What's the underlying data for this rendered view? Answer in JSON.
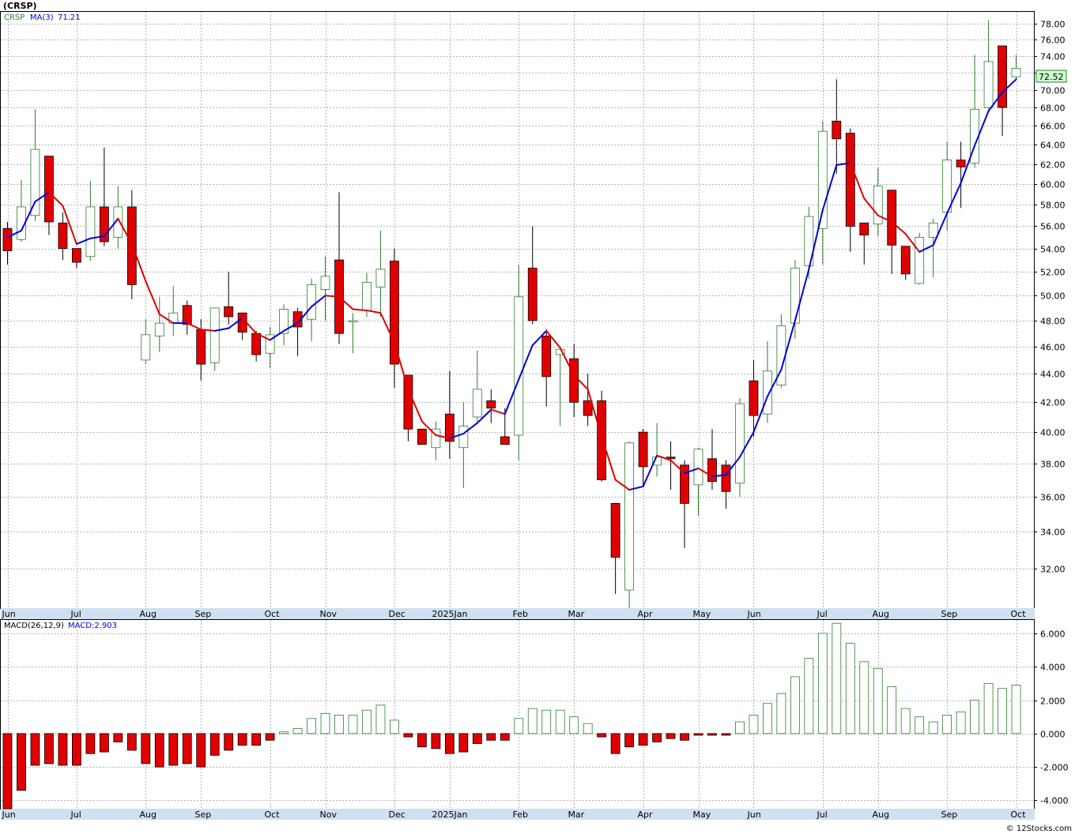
{
  "title": "(CRSP)",
  "legend": {
    "symbol": "CRSP",
    "ma_label": "MA(3)",
    "ma_value": "71.21",
    "macd_params": "MACD(26,12,9)",
    "macd_value": "MACD:2.903"
  },
  "last_price_badge": "72.52",
  "copyright": "© 12Stocks.com",
  "colors": {
    "up_candle": "#ffffff",
    "up_outline": "#2e7d32",
    "down_candle": "#e00000",
    "ma_up": "#0000dd",
    "ma_down": "#e00000",
    "macd_pos": "#2e7d32",
    "macd_neg": "#e00000",
    "grid": "#b5b5b5",
    "axis_bar": "#cfe0f0",
    "badge_bg": "#ccffcc"
  },
  "chart_data": [
    {
      "type": "candlestick",
      "interval": "weekly",
      "y_scale": "log",
      "ylim": [
        30,
        79.5
      ],
      "y_ticks": [
        "32.00",
        "34.00",
        "36.00",
        "38.00",
        "40.00",
        "42.00",
        "44.00",
        "46.00",
        "48.00",
        "50.00",
        "52.00",
        "54.00",
        "56.00",
        "58.00",
        "60.00",
        "62.00",
        "64.00",
        "66.00",
        "68.00",
        "70.00",
        "72.00",
        "74.00",
        "76.00",
        "78.00"
      ],
      "x_month_labels": [
        "Jun",
        "Jul",
        "Aug",
        "Sep",
        "Oct",
        "Nov",
        "Dec",
        "2025Jan",
        "Feb",
        "Mar",
        "Apr",
        "May",
        "Jun",
        "Jul",
        "Aug",
        "Sep",
        "Oct"
      ],
      "month_start_index": [
        0,
        5,
        10,
        14,
        19,
        23,
        28,
        32,
        37,
        41,
        46,
        50,
        54,
        59,
        63,
        68,
        73
      ],
      "candles": [
        {
          "o": 55.8,
          "h": 56.4,
          "l": 52.6,
          "c": 53.8
        },
        {
          "o": 54.8,
          "h": 60.4,
          "l": 54.6,
          "c": 57.8
        },
        {
          "o": 57.0,
          "h": 67.8,
          "l": 56.5,
          "c": 63.5
        },
        {
          "o": 62.8,
          "h": 62.8,
          "l": 55.2,
          "c": 56.4
        },
        {
          "o": 56.3,
          "h": 57.3,
          "l": 53.0,
          "c": 54.0
        },
        {
          "o": 54.0,
          "h": 54.0,
          "l": 52.3,
          "c": 52.8
        },
        {
          "o": 53.3,
          "h": 60.3,
          "l": 52.9,
          "c": 57.8
        },
        {
          "o": 57.8,
          "h": 63.7,
          "l": 54.2,
          "c": 54.6
        },
        {
          "o": 55.0,
          "h": 59.8,
          "l": 54.0,
          "c": 57.8
        },
        {
          "o": 57.8,
          "h": 59.4,
          "l": 49.7,
          "c": 50.9
        },
        {
          "o": 45.0,
          "h": 48.1,
          "l": 44.7,
          "c": 46.9
        },
        {
          "o": 46.8,
          "h": 49.9,
          "l": 45.6,
          "c": 47.8
        },
        {
          "o": 47.8,
          "h": 50.8,
          "l": 46.8,
          "c": 48.6
        },
        {
          "o": 49.2,
          "h": 49.6,
          "l": 46.9,
          "c": 47.7
        },
        {
          "o": 47.3,
          "h": 48.1,
          "l": 43.5,
          "c": 44.7
        },
        {
          "o": 44.8,
          "h": 49.0,
          "l": 44.2,
          "c": 49.0
        },
        {
          "o": 49.1,
          "h": 52.0,
          "l": 47.7,
          "c": 48.3
        },
        {
          "o": 48.6,
          "h": 48.6,
          "l": 46.5,
          "c": 47.1
        },
        {
          "o": 47.0,
          "h": 47.2,
          "l": 44.9,
          "c": 45.4
        },
        {
          "o": 45.5,
          "h": 47.5,
          "l": 44.4,
          "c": 46.9
        },
        {
          "o": 47.0,
          "h": 49.3,
          "l": 46.1,
          "c": 48.9
        },
        {
          "o": 48.7,
          "h": 49.0,
          "l": 45.3,
          "c": 47.5
        },
        {
          "o": 48.1,
          "h": 51.4,
          "l": 46.4,
          "c": 50.9
        },
        {
          "o": 50.5,
          "h": 53.3,
          "l": 48.0,
          "c": 51.6
        },
        {
          "o": 53.0,
          "h": 59.2,
          "l": 46.2,
          "c": 47.0
        },
        {
          "o": 47.9,
          "h": 48.6,
          "l": 45.5,
          "c": 48.0
        },
        {
          "o": 48.8,
          "h": 51.9,
          "l": 48.3,
          "c": 51.1
        },
        {
          "o": 50.7,
          "h": 55.6,
          "l": 48.3,
          "c": 52.2
        },
        {
          "o": 52.9,
          "h": 54.0,
          "l": 43.0,
          "c": 44.7
        },
        {
          "o": 43.9,
          "h": 43.9,
          "l": 39.4,
          "c": 40.2
        },
        {
          "o": 40.2,
          "h": 40.2,
          "l": 39.2,
          "c": 39.2
        },
        {
          "o": 39.0,
          "h": 40.7,
          "l": 38.2,
          "c": 40.2
        },
        {
          "o": 41.2,
          "h": 44.2,
          "l": 38.3,
          "c": 39.4
        },
        {
          "o": 39.0,
          "h": 42.0,
          "l": 36.5,
          "c": 40.4
        },
        {
          "o": 41.0,
          "h": 45.7,
          "l": 40.7,
          "c": 42.9
        },
        {
          "o": 42.1,
          "h": 42.9,
          "l": 40.6,
          "c": 41.6
        },
        {
          "o": 39.7,
          "h": 41.6,
          "l": 39.2,
          "c": 39.2
        },
        {
          "o": 39.8,
          "h": 52.6,
          "l": 38.2,
          "c": 49.9
        },
        {
          "o": 52.3,
          "h": 56.0,
          "l": 47.7,
          "c": 48.0
        },
        {
          "o": 46.8,
          "h": 47.3,
          "l": 41.7,
          "c": 43.8
        },
        {
          "o": 45.4,
          "h": 45.9,
          "l": 40.4,
          "c": 45.8
        },
        {
          "o": 45.1,
          "h": 46.2,
          "l": 41.0,
          "c": 42.0
        },
        {
          "o": 42.1,
          "h": 44.0,
          "l": 40.4,
          "c": 41.1
        },
        {
          "o": 42.1,
          "h": 42.8,
          "l": 36.9,
          "c": 37.0
        },
        {
          "o": 35.6,
          "h": 35.6,
          "l": 30.7,
          "c": 32.6
        },
        {
          "o": 30.9,
          "h": 39.4,
          "l": 30.0,
          "c": 39.3
        },
        {
          "o": 40.0,
          "h": 40.2,
          "l": 36.6,
          "c": 37.8
        },
        {
          "o": 37.9,
          "h": 40.6,
          "l": 37.2,
          "c": 38.4
        },
        {
          "o": 38.4,
          "h": 39.4,
          "l": 36.4,
          "c": 38.3
        },
        {
          "o": 37.9,
          "h": 38.2,
          "l": 33.1,
          "c": 35.6
        },
        {
          "o": 36.7,
          "h": 39.0,
          "l": 34.9,
          "c": 38.9
        },
        {
          "o": 38.3,
          "h": 40.2,
          "l": 36.4,
          "c": 36.9
        },
        {
          "o": 37.9,
          "h": 38.2,
          "l": 35.3,
          "c": 36.3
        },
        {
          "o": 36.8,
          "h": 42.3,
          "l": 36.0,
          "c": 41.9
        },
        {
          "o": 43.5,
          "h": 45.0,
          "l": 39.7,
          "c": 41.1
        },
        {
          "o": 41.2,
          "h": 46.4,
          "l": 40.6,
          "c": 44.2
        },
        {
          "o": 43.2,
          "h": 48.5,
          "l": 43.0,
          "c": 47.6
        },
        {
          "o": 47.8,
          "h": 53.0,
          "l": 46.6,
          "c": 52.3
        },
        {
          "o": 52.5,
          "h": 57.8,
          "l": 51.4,
          "c": 56.9
        },
        {
          "o": 55.8,
          "h": 66.5,
          "l": 52.6,
          "c": 65.4
        },
        {
          "o": 66.5,
          "h": 71.2,
          "l": 61.0,
          "c": 64.6
        },
        {
          "o": 65.2,
          "h": 65.7,
          "l": 53.7,
          "c": 56.0
        },
        {
          "o": 56.3,
          "h": 56.3,
          "l": 52.6,
          "c": 55.2
        },
        {
          "o": 56.2,
          "h": 61.6,
          "l": 55.1,
          "c": 59.8
        },
        {
          "o": 59.4,
          "h": 59.4,
          "l": 51.8,
          "c": 54.3
        },
        {
          "o": 54.2,
          "h": 54.2,
          "l": 51.3,
          "c": 51.8
        },
        {
          "o": 51.0,
          "h": 55.4,
          "l": 50.9,
          "c": 55.0
        },
        {
          "o": 55.0,
          "h": 56.7,
          "l": 51.5,
          "c": 56.3
        },
        {
          "o": 57.3,
          "h": 64.3,
          "l": 55.6,
          "c": 62.4
        },
        {
          "o": 62.4,
          "h": 64.3,
          "l": 57.7,
          "c": 61.7
        },
        {
          "o": 62.1,
          "h": 74.1,
          "l": 61.6,
          "c": 67.8
        },
        {
          "o": 68.0,
          "h": 78.4,
          "l": 67.8,
          "c": 73.3
        },
        {
          "o": 75.2,
          "h": 75.2,
          "l": 64.9,
          "c": 68.0
        },
        {
          "o": 71.5,
          "h": 74.1,
          "l": 71.2,
          "c": 72.5
        }
      ],
      "ma3": [
        55.0,
        55.6,
        58.3,
        59.2,
        57.9,
        54.4,
        54.9,
        55.1,
        56.7,
        54.4,
        51.2,
        48.5,
        47.8,
        47.8,
        47.3,
        47.2,
        47.4,
        48.2,
        47.0,
        46.5,
        47.2,
        47.8,
        49.1,
        50.0,
        49.9,
        48.9,
        48.8,
        48.6,
        46.3,
        42.9,
        40.7,
        39.8,
        39.6,
        39.9,
        40.6,
        41.5,
        41.2,
        43.6,
        46.1,
        47.2,
        45.9,
        43.9,
        42.9,
        39.7,
        37.0,
        36.4,
        36.6,
        38.5,
        38.2,
        37.4,
        37.7,
        37.2,
        37.3,
        38.4,
        40.0,
        42.4,
        44.3,
        48.0,
        52.2,
        57.5,
        61.9,
        62.1,
        58.6,
        57.0,
        56.4,
        55.3,
        53.7,
        54.3,
        57.2,
        60.1,
        63.9,
        67.6,
        69.7,
        71.2
      ],
      "ma3_color_by_slope": true
    },
    {
      "type": "bar",
      "name": "MACD(26,12,9)",
      "ylim": [
        -4.5,
        6.8
      ],
      "y_ticks": [
        "-4.000",
        "-2.000",
        "0.000",
        "2.000",
        "4.000",
        "6.000"
      ],
      "values": [
        -4.5,
        -3.4,
        -1.9,
        -1.8,
        -1.9,
        -1.9,
        -1.2,
        -1.1,
        -0.5,
        -1.0,
        -1.8,
        -2.0,
        -1.9,
        -1.8,
        -2.0,
        -1.3,
        -1.0,
        -0.7,
        -0.7,
        -0.4,
        0.1,
        0.3,
        0.9,
        1.2,
        1.1,
        1.1,
        1.4,
        1.7,
        0.8,
        -0.2,
        -0.8,
        -0.9,
        -1.2,
        -1.1,
        -0.6,
        -0.4,
        -0.4,
        0.9,
        1.5,
        1.4,
        1.4,
        1.0,
        0.6,
        -0.2,
        -1.2,
        -0.8,
        -0.7,
        -0.5,
        -0.3,
        -0.4,
        -0.1,
        -0.1,
        -0.1,
        0.7,
        1.1,
        1.8,
        2.4,
        3.4,
        4.5,
        6.0,
        6.6,
        5.4,
        4.3,
        3.9,
        2.8,
        1.5,
        1.0,
        0.7,
        1.1,
        1.3,
        2.0,
        3.0,
        2.7,
        2.9
      ]
    }
  ]
}
